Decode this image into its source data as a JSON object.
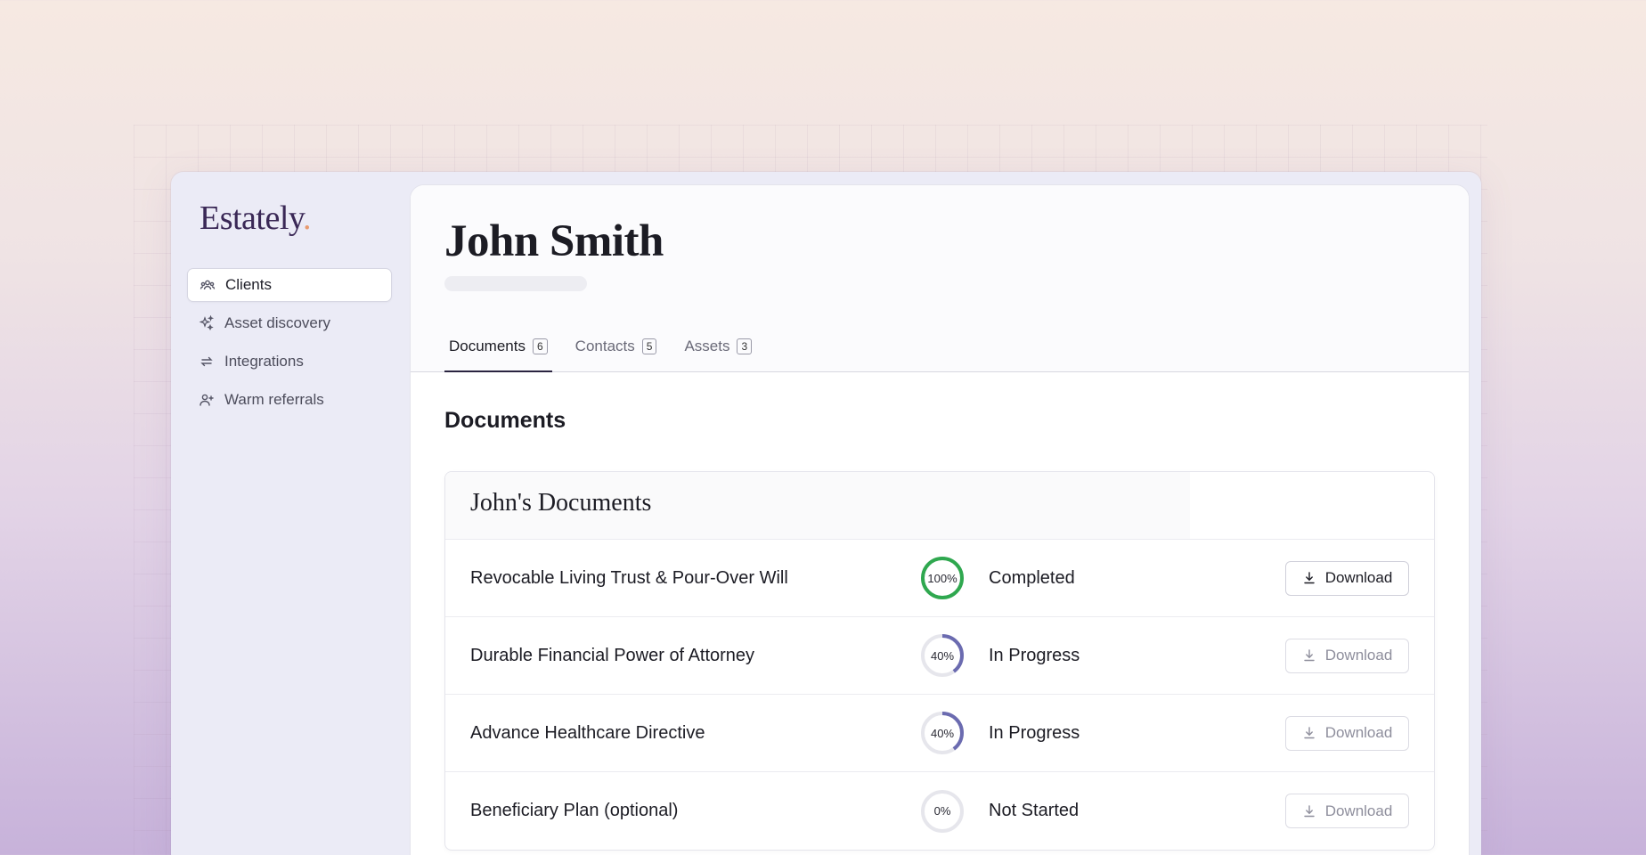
{
  "app": {
    "logo_text": "Estately",
    "logo_dot": ".",
    "accent": "#e89a6f",
    "brand": "#3a2856"
  },
  "sidebar": {
    "items": [
      {
        "label": "Clients",
        "icon": "users-icon",
        "active": true
      },
      {
        "label": "Asset discovery",
        "icon": "sparkles-icon",
        "active": false
      },
      {
        "label": "Integrations",
        "icon": "arrows-swap-icon",
        "active": false
      },
      {
        "label": "Warm referrals",
        "icon": "user-plus-icon",
        "active": false
      }
    ]
  },
  "client": {
    "name": "John Smith"
  },
  "tabs": [
    {
      "label": "Documents",
      "count": "6",
      "active": true
    },
    {
      "label": "Contacts",
      "count": "5",
      "active": false
    },
    {
      "label": "Assets",
      "count": "3",
      "active": false
    }
  ],
  "section": {
    "title": "Documents"
  },
  "card": {
    "title": "John's Documents"
  },
  "documents": [
    {
      "name": "Revocable Living Trust & Pour-Over Will",
      "progress": 100,
      "progress_label": "100%",
      "status": "Completed",
      "color": "#2fa84f",
      "download_label": "Download",
      "download_enabled": true
    },
    {
      "name": "Durable Financial Power of Attorney",
      "progress": 40,
      "progress_label": "40%",
      "status": "In Progress",
      "color": "#6b6bb0",
      "download_label": "Download",
      "download_enabled": false
    },
    {
      "name": "Advance Healthcare Directive",
      "progress": 40,
      "progress_label": "40%",
      "status": "In Progress",
      "color": "#6b6bb0",
      "download_label": "Download",
      "download_enabled": false
    },
    {
      "name": "Beneficiary Plan (optional)",
      "progress": 0,
      "progress_label": "0%",
      "status": "Not Started",
      "color": "#6b6bb0",
      "download_label": "Download",
      "download_enabled": false
    }
  ]
}
